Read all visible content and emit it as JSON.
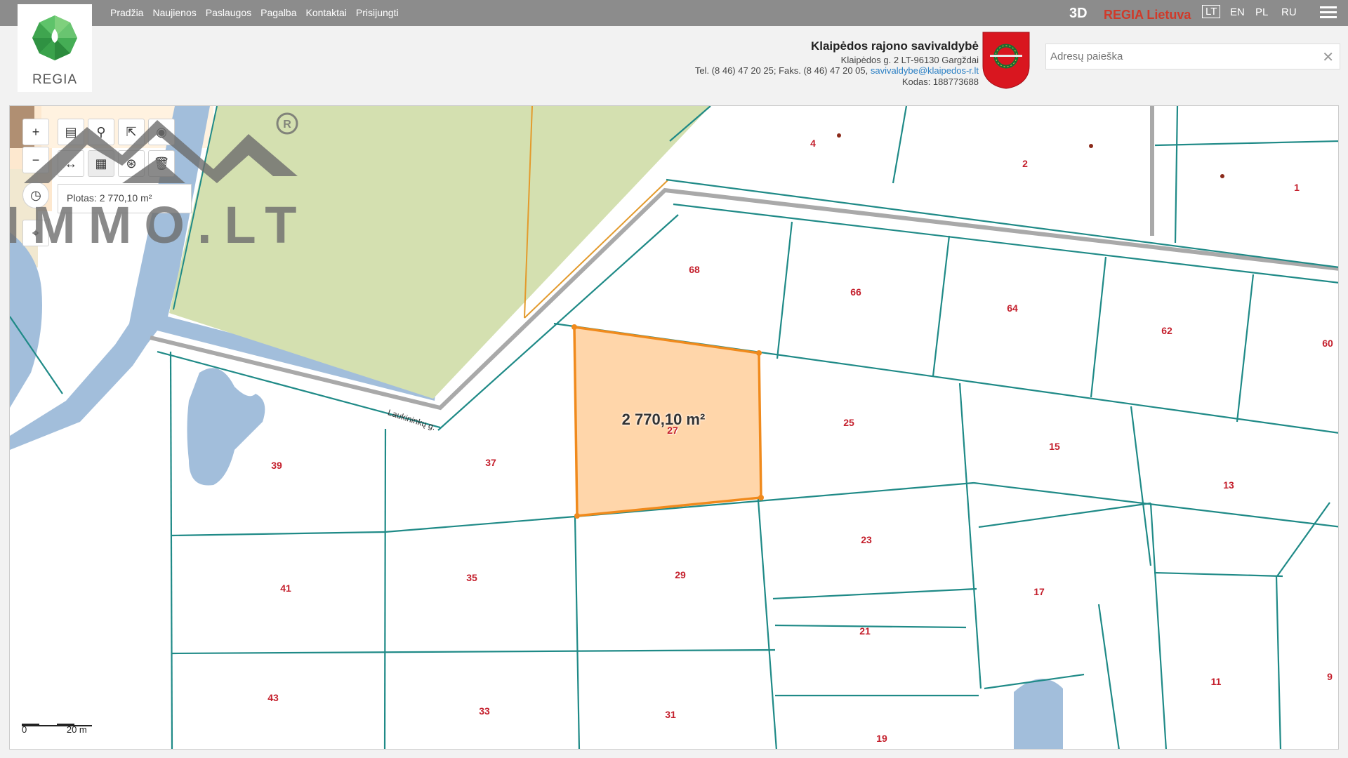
{
  "nav": [
    "Pradžia",
    "Naujienos",
    "Paslaugos",
    "Pagalba",
    "Kontaktai",
    "Prisijungti"
  ],
  "top_right": {
    "btn_3d": "3D",
    "regia": "REGIA Lietuva",
    "languages": [
      "LT",
      "EN",
      "PL",
      "RU"
    ],
    "active_language": "LT"
  },
  "logo_text": "REGIA",
  "municipality": {
    "name": "Klaipėdos rajono savivaldybė",
    "address": "Klaipėdos g. 2 LT-96130 Gargždai",
    "phone": "Tel. (8 46) 47 20 25; Faks. (8 46) 47 20 05,",
    "email": "savivaldybe@klaipedos-r.lt",
    "code": "Kodas: 188773688"
  },
  "search": {
    "placeholder": "Adresų paieška"
  },
  "measure": {
    "area_label": "Plotas: 2 770,10 m²",
    "map_area": "2 770,10 m²"
  },
  "street_name": "Laukininkų g.",
  "scale": {
    "zero": "0",
    "distance": "20 m"
  },
  "parcels": [
    "4",
    "2",
    "1",
    "68",
    "66",
    "64",
    "62",
    "60",
    "27",
    "25",
    "15",
    "13",
    "39",
    "37",
    "35",
    "29",
    "23",
    "17",
    "41",
    "21",
    "43",
    "33",
    "31",
    "19",
    "11",
    "9"
  ],
  "watermark": "IMMO.LT",
  "colors": {
    "parcel_line": "#1f8a87",
    "selection_fill": "#ffd6aa",
    "selection_stroke": "#f08a1c",
    "forest": "#d4e0b0",
    "water": "#a2bedb",
    "label": "#c41f2c"
  }
}
